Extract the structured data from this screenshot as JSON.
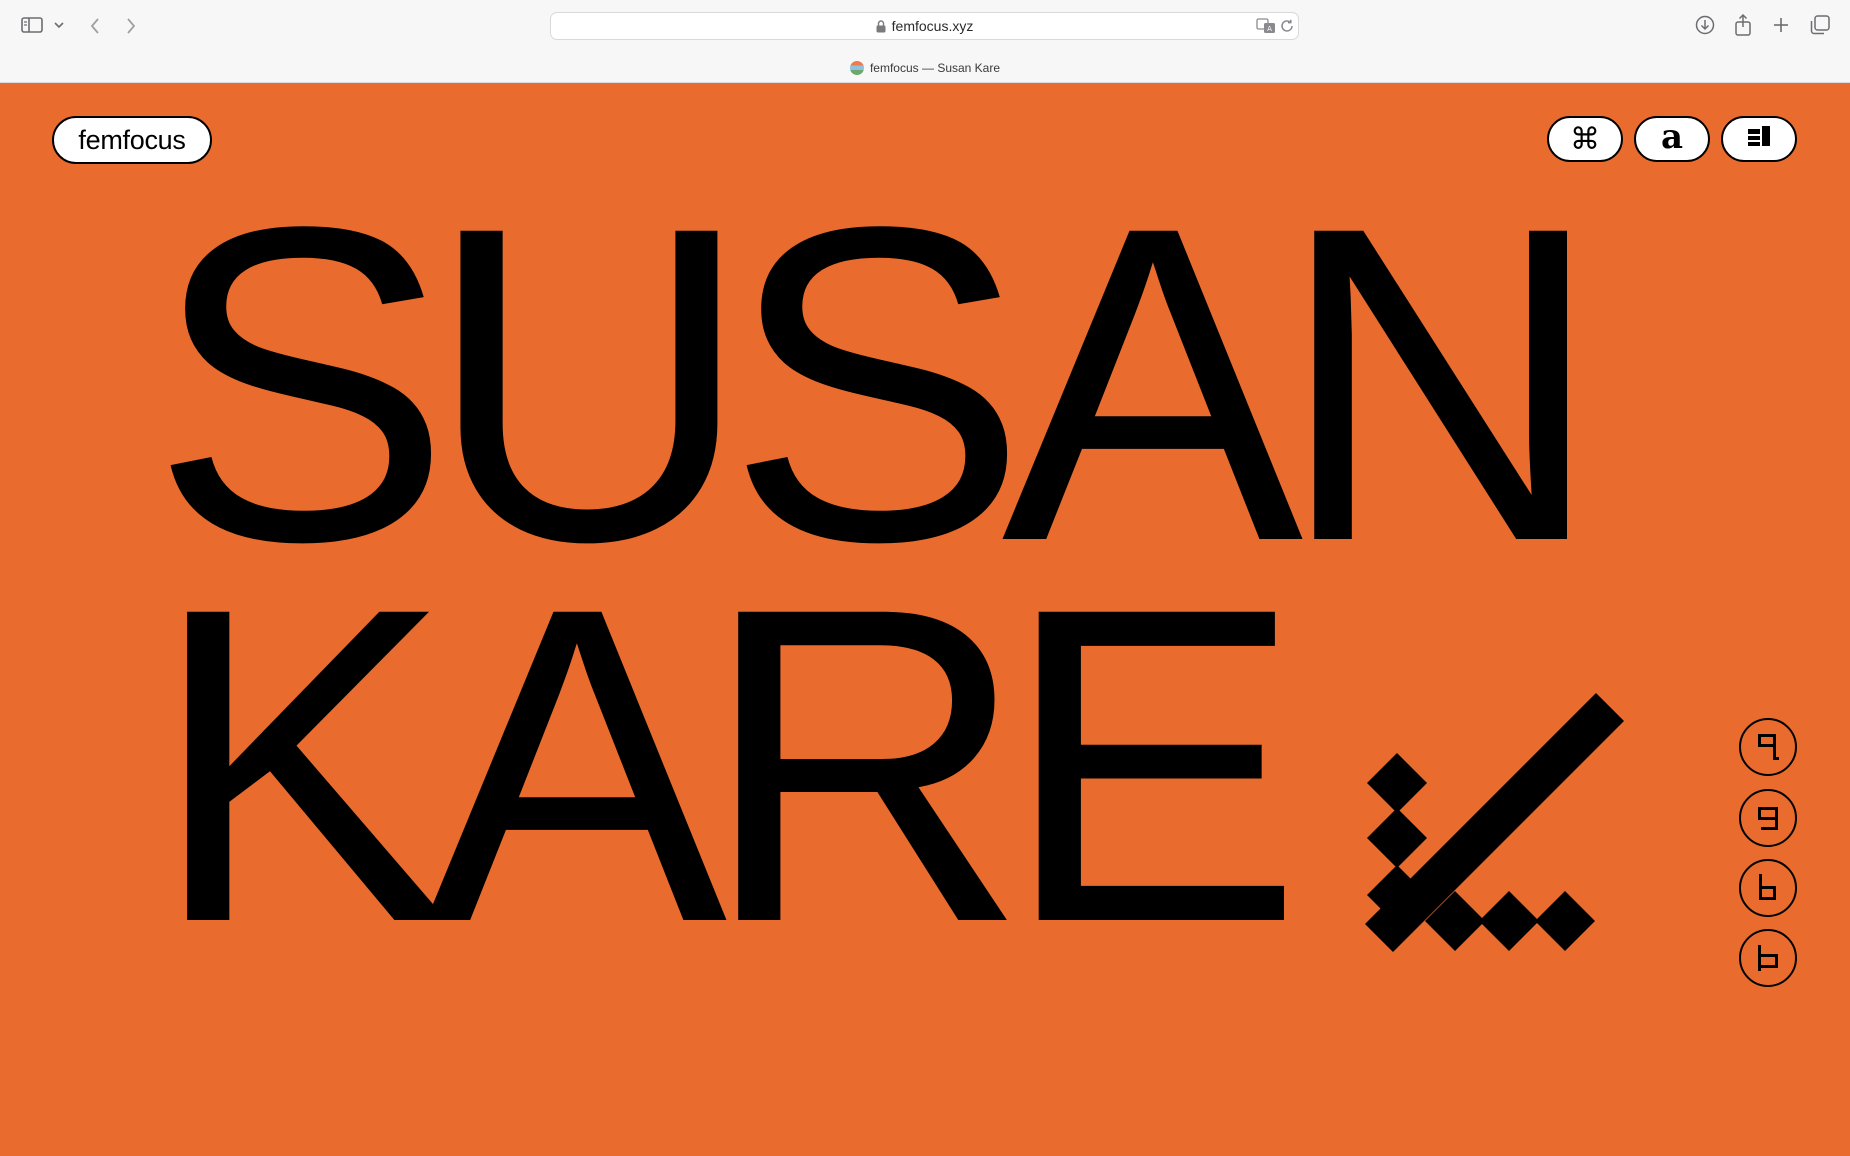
{
  "browser": {
    "url": "femfocus.xyz",
    "tab_title": "femfocus — Susan Kare"
  },
  "site": {
    "logo": "femfocus",
    "nav_icons": [
      "command-key-icon",
      "letter-a-icon",
      "layout-panels-icon"
    ],
    "nav_command_glyph": "⌘",
    "nav_letter_glyph": "a"
  },
  "hero": {
    "line1": "SUSAN",
    "line2": "KARE"
  },
  "colors": {
    "background": "#e96b2e",
    "foreground": "#000000",
    "chrome": "#f7f7f8"
  },
  "side_buttons": [
    "pixel-q-icon",
    "pixel-g-icon",
    "pixel-b-icon",
    "pixel-p-icon"
  ]
}
